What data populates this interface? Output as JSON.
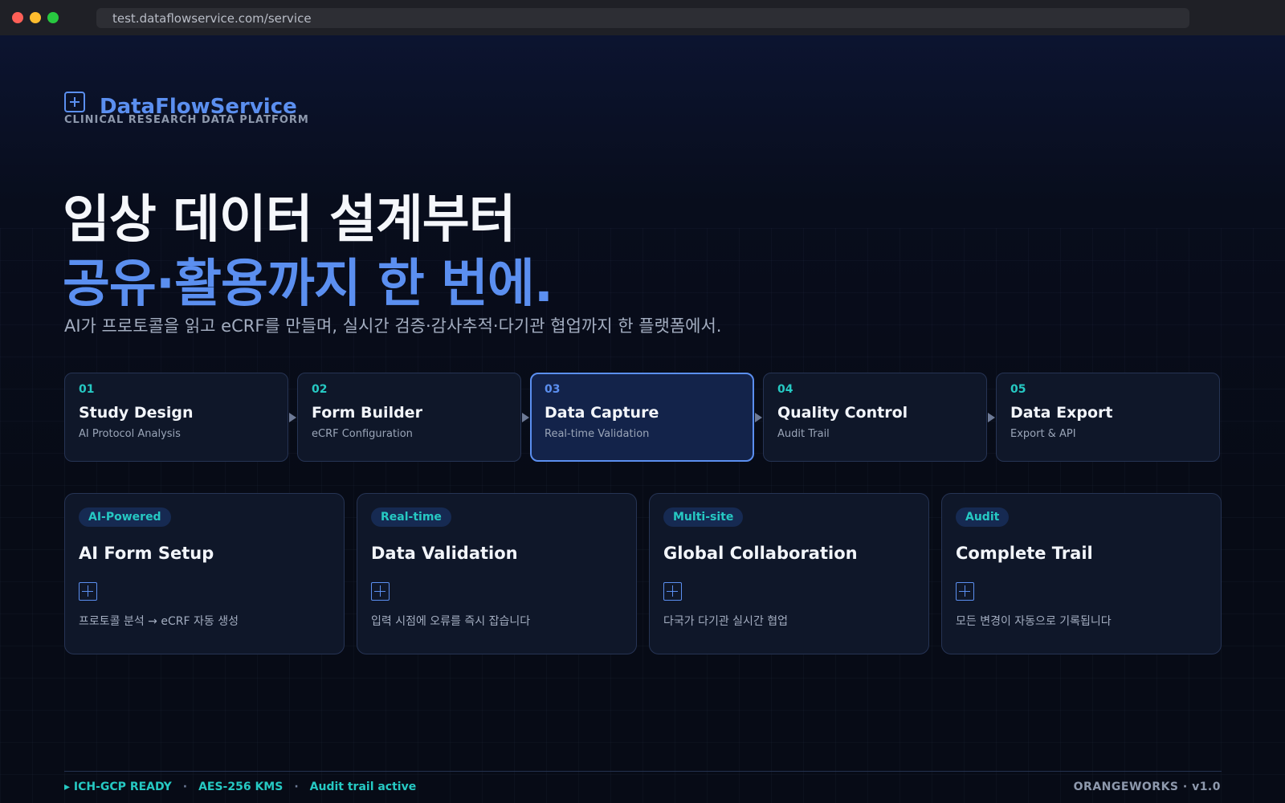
{
  "browser": {
    "url": "test.dataflowservice.com/service"
  },
  "brand": {
    "name": "DataFlowService",
    "tagline": "CLINICAL RESEARCH DATA PLATFORM",
    "icon": "plus-box-icon"
  },
  "hero": {
    "line1": "임상 데이터 설계부터",
    "line2": "공유·활용까지 한 번에.",
    "subtitle": "AI가 프로토콜을 읽고 eCRF를 만들며, 실시간 검증·감사추적·다기관 협업까지 한 플랫폼에서."
  },
  "steps": [
    {
      "num": "01",
      "title": "Study Design",
      "sub": "AI Protocol Analysis"
    },
    {
      "num": "02",
      "title": "Form Builder",
      "sub": "eCRF Configuration"
    },
    {
      "num": "03",
      "title": "Data Capture",
      "sub": "Real-time Validation"
    },
    {
      "num": "04",
      "title": "Quality Control",
      "sub": "Audit Trail"
    },
    {
      "num": "05",
      "title": "Data Export",
      "sub": "Export & API"
    }
  ],
  "active_step": "03",
  "features": [
    {
      "tag": "AI-Powered",
      "title": "AI Form Setup",
      "desc": "프로토콜 분석 → eCRF 자동 생성",
      "icon": "plus-box-icon"
    },
    {
      "tag": "Real-time",
      "title": "Data Validation",
      "desc": "입력 시점에 오류를 즉시 잡습니다",
      "icon": "plus-box-icon"
    },
    {
      "tag": "Multi-site",
      "title": "Global Collaboration",
      "desc": "다국가 다기관 실시간 협업",
      "icon": "plus-box-icon"
    },
    {
      "tag": "Audit",
      "title": "Complete Trail",
      "desc": "모든 변경이 자동으로 기록됩니다",
      "icon": "plus-box-icon"
    }
  ],
  "footer": {
    "status": [
      "▸ ICH-GCP READY",
      "AES-256 KMS",
      "Audit trail active"
    ],
    "separator": "·",
    "credit": "ORANGEWORKS · v1.0"
  },
  "colors": {
    "accent": "#5b8ff0",
    "teal": "#26c9c3",
    "background": "#070b16",
    "card": "#0f1729"
  }
}
